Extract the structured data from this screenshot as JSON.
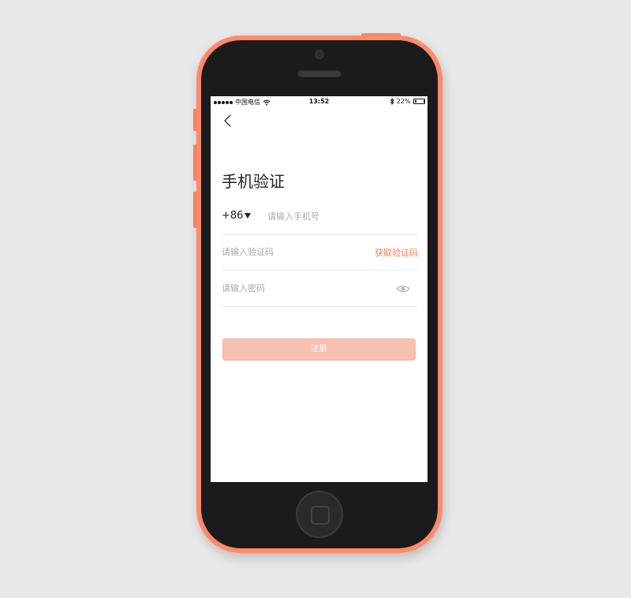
{
  "device": {
    "shell_color": "#ff8a6a",
    "bezel_color": "#1b1b1b"
  },
  "status_bar": {
    "carrier": "中国电信",
    "time": "13:52",
    "battery": "22%",
    "battery_level": 0.22
  },
  "page": {
    "title": "手机验证",
    "back_icon": "chevron-left-icon"
  },
  "form": {
    "country_code": "+86",
    "phone_placeholder": "请输入手机号",
    "code_placeholder": "请输入验证码",
    "get_code_label": "获取验证码",
    "password_placeholder": "请输入密码",
    "eye_icon": "eye-icon",
    "submit_label": "注册"
  },
  "colors": {
    "accent": "#f2815f",
    "button_disabled": "#f7c1b1"
  }
}
